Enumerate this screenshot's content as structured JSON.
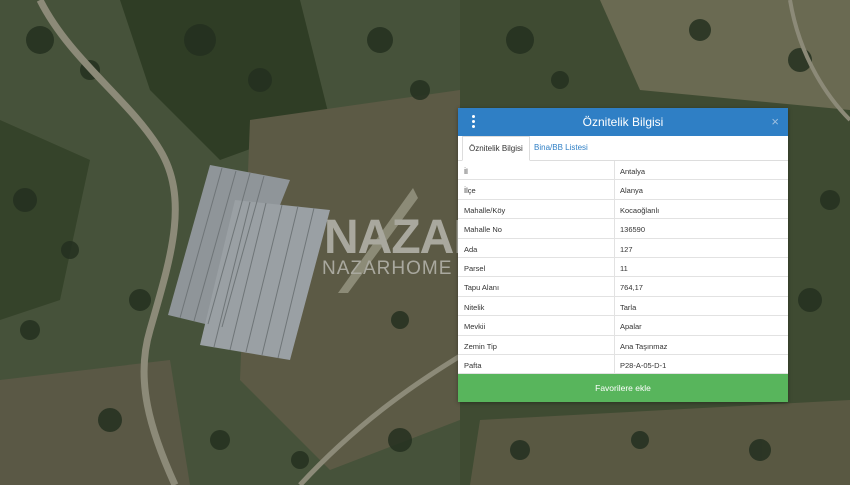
{
  "watermark": {
    "brand": "NAZAR",
    "brand_sub": "NAZARHOME"
  },
  "panel": {
    "title": "Öznitelik Bilgisi",
    "close_symbol": "×",
    "tabs": [
      {
        "label": "Öznitelik Bilgisi",
        "active": true
      },
      {
        "label": "Bina/BB Listesi",
        "active": false
      }
    ],
    "rows": [
      {
        "key": "İl",
        "value": "Antalya"
      },
      {
        "key": "İlçe",
        "value": "Alanya"
      },
      {
        "key": "Mahalle/Köy",
        "value": "Kocaoğlanlı"
      },
      {
        "key": "Mahalle No",
        "value": "136590"
      },
      {
        "key": "Ada",
        "value": "127"
      },
      {
        "key": "Parsel",
        "value": "11"
      },
      {
        "key": "Tapu Alanı",
        "value": "764,17"
      },
      {
        "key": "Nitelik",
        "value": "Tarla"
      },
      {
        "key": "Mevkii",
        "value": "Apalar"
      },
      {
        "key": "Zemin Tip",
        "value": "Ana Taşınmaz"
      },
      {
        "key": "Pafta",
        "value": "P28-A-05-D-1"
      }
    ],
    "favorite_button": "Favorilere ekle"
  },
  "colors": {
    "header": "#2f7fc5",
    "button": "#58b55c",
    "terrain": "#3c4a30"
  }
}
